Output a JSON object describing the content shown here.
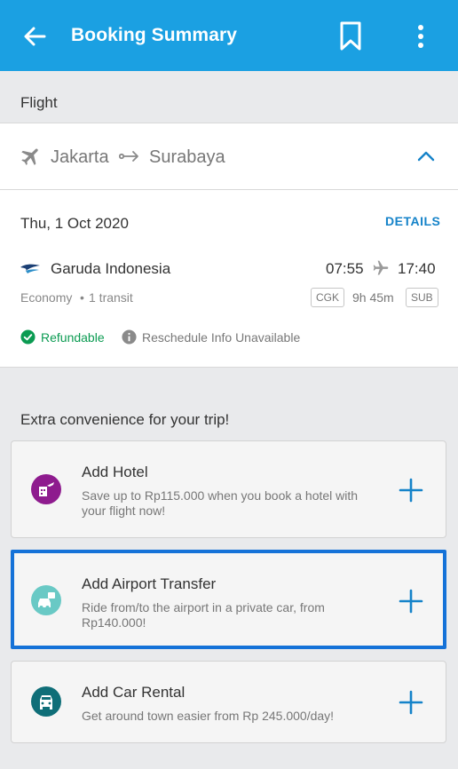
{
  "header": {
    "title": "Booking Summary",
    "icons": [
      "back-arrow-icon",
      "bookmark-icon",
      "more-vert-icon"
    ]
  },
  "flight_section": {
    "label": "Flight",
    "origin": "Jakarta",
    "destination": "Surabaya"
  },
  "flight": {
    "date": "Thu, 1 Oct 2020",
    "details_label": "DETAILS",
    "airline": "Garuda Indonesia",
    "departure_time": "07:55",
    "arrival_time": "17:40",
    "cabin": "Economy",
    "separator": "•",
    "transit": "1 transit",
    "origin_code": "CGK",
    "duration": "9h 45m",
    "destination_code": "SUB",
    "refund_label": "Refundable",
    "reschedule_label": "Reschedule Info Unavailable"
  },
  "extras": {
    "title": "Extra convenience for your trip!",
    "items": [
      {
        "title": "Add Hotel",
        "description": "Save up to Rp115.000 when you book a hotel with your flight now!",
        "icon": "hotel-flight-icon",
        "color": "#8e1b8e"
      },
      {
        "title": "Add Airport Transfer",
        "description": "Ride from/to the airport in a private car, from Rp140.000!",
        "icon": "airport-transfer-icon",
        "color": "#69c9c5"
      },
      {
        "title": "Add Car Rental",
        "description": "Get around town easier from Rp 245.000/day!",
        "icon": "car-rental-icon",
        "color": "#0f6e78"
      }
    ]
  },
  "colors": {
    "primary": "#1ba0e2",
    "accent": "#1583c9",
    "success": "#0b9b52",
    "selection": "#1572d8"
  }
}
